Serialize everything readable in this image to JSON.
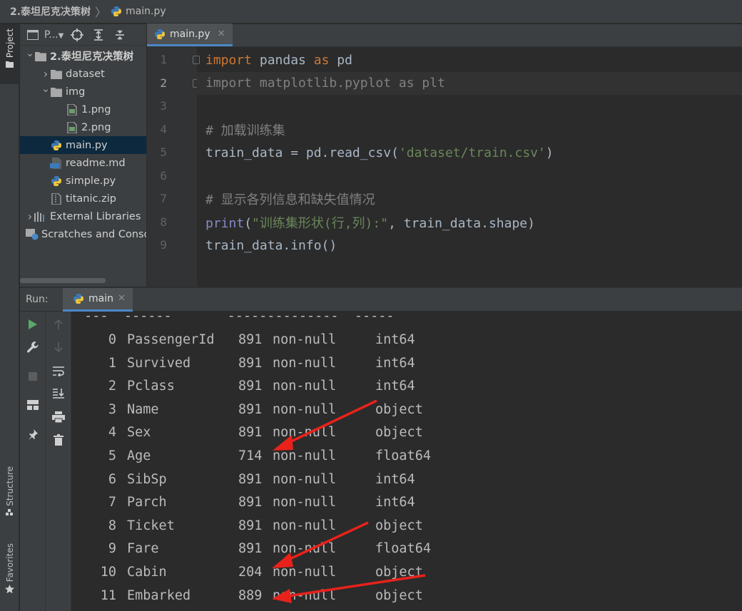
{
  "breadcrumb": {
    "project": "2.泰坦尼克决策树",
    "file": "main.py"
  },
  "left_strip": {
    "project_tab": "Project",
    "structure_tab": "Structure",
    "favorites_tab": "Favorites"
  },
  "project_panel": {
    "view_label": "P..."
  },
  "tree": [
    {
      "label": "2.泰坦尼克决策树",
      "type": "folder",
      "expanded": true,
      "depth": 0
    },
    {
      "label": "dataset",
      "type": "folder",
      "expanded": false,
      "depth": 1
    },
    {
      "label": "img",
      "type": "folder",
      "expanded": true,
      "depth": 1
    },
    {
      "label": "1.png",
      "type": "image",
      "depth": 2
    },
    {
      "label": "2.png",
      "type": "image",
      "depth": 2
    },
    {
      "label": "main.py",
      "type": "python",
      "depth": 1,
      "selected": true
    },
    {
      "label": "readme.md",
      "type": "markdown",
      "depth": 1
    },
    {
      "label": "simple.py",
      "type": "python",
      "depth": 1
    },
    {
      "label": "titanic.zip",
      "type": "archive",
      "depth": 1
    },
    {
      "label": "External Libraries",
      "type": "libraries",
      "depth": 0
    },
    {
      "label": "Scratches and Consoles",
      "type": "scratches",
      "depth": 0
    }
  ],
  "editor": {
    "tab_label": "main.py",
    "current_line": 2,
    "lines": [
      {
        "no": "1",
        "tokens": [
          {
            "t": "import",
            "c": "kw"
          },
          {
            "t": " pandas ",
            "c": ""
          },
          {
            "t": "as",
            "c": "kw"
          },
          {
            "t": " pd",
            "c": ""
          }
        ]
      },
      {
        "no": "2",
        "tokens": [
          {
            "t": "import matplotlib.pyplot as plt",
            "c": "cmt"
          }
        ]
      },
      {
        "no": "3",
        "tokens": []
      },
      {
        "no": "4",
        "tokens": [
          {
            "t": "# 加载训练集",
            "c": "cmt"
          }
        ]
      },
      {
        "no": "5",
        "tokens": [
          {
            "t": "train_data = pd.read_csv(",
            "c": ""
          },
          {
            "t": "'dataset/train.csv'",
            "c": "str"
          },
          {
            "t": ")",
            "c": ""
          }
        ]
      },
      {
        "no": "6",
        "tokens": []
      },
      {
        "no": "7",
        "tokens": [
          {
            "t": "# 显示各列信息和缺失值情况",
            "c": "cmt"
          }
        ]
      },
      {
        "no": "8",
        "tokens": [
          {
            "t": "print",
            "c": "builtin"
          },
          {
            "t": "(",
            "c": ""
          },
          {
            "t": "\"训练集形状(行,列):\"",
            "c": "str"
          },
          {
            "t": ", train_data.shape)",
            "c": ""
          }
        ]
      },
      {
        "no": "9",
        "tokens": [
          {
            "t": "train_data.info()",
            "c": ""
          }
        ]
      }
    ]
  },
  "run": {
    "title": "Run:",
    "tab_label": "main"
  },
  "console": {
    "header_line": " ---  ------       --------------  -----",
    "rows": [
      {
        "idx": "0",
        "column": "PassengerId",
        "count": "891",
        "nn": "non-null",
        "dtype": "int64"
      },
      {
        "idx": "1",
        "column": "Survived",
        "count": "891",
        "nn": "non-null",
        "dtype": "int64"
      },
      {
        "idx": "2",
        "column": "Pclass",
        "count": "891",
        "nn": "non-null",
        "dtype": "int64"
      },
      {
        "idx": "3",
        "column": "Name",
        "count": "891",
        "nn": "non-null",
        "dtype": "object"
      },
      {
        "idx": "4",
        "column": "Sex",
        "count": "891",
        "nn": "non-null",
        "dtype": "object"
      },
      {
        "idx": "5",
        "column": "Age",
        "count": "714",
        "nn": "non-null",
        "dtype": "float64"
      },
      {
        "idx": "6",
        "column": "SibSp",
        "count": "891",
        "nn": "non-null",
        "dtype": "int64"
      },
      {
        "idx": "7",
        "column": "Parch",
        "count": "891",
        "nn": "non-null",
        "dtype": "int64"
      },
      {
        "idx": "8",
        "column": "Ticket",
        "count": "891",
        "nn": "non-null",
        "dtype": "object"
      },
      {
        "idx": "9",
        "column": "Fare",
        "count": "891",
        "nn": "non-null",
        "dtype": "float64"
      },
      {
        "idx": "10",
        "column": "Cabin",
        "count": "204",
        "nn": "non-null",
        "dtype": "object"
      },
      {
        "idx": "11",
        "column": "Embarked",
        "count": "889",
        "nn": "non-null",
        "dtype": "object"
      }
    ]
  },
  "colors": {
    "annotation_arrow": "#e8221b",
    "selection": "#0d293e",
    "tab_underline": "#4a88c7"
  }
}
